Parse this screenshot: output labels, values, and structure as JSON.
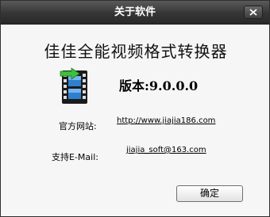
{
  "window": {
    "title": "关于软件",
    "close_icon": "close-icon"
  },
  "about": {
    "app_name": "佳佳全能视频格式转换器",
    "app_icon": "film-strip-icon",
    "version": "版本:9.0.0.0",
    "website_label": "官方网站:",
    "website_url": "http://www.jiajia186.com",
    "email_label": "支持E-Mail:",
    "email": "jiajia_soft@163.com"
  },
  "buttons": {
    "ok_label": "确定"
  },
  "colors": {
    "titlebar": "#353535",
    "dialog_background": "#f6f6f6",
    "icon_film": "#1b1b1b",
    "icon_frame": "#2f7fd0",
    "icon_arrow": "#3fbf3f"
  }
}
